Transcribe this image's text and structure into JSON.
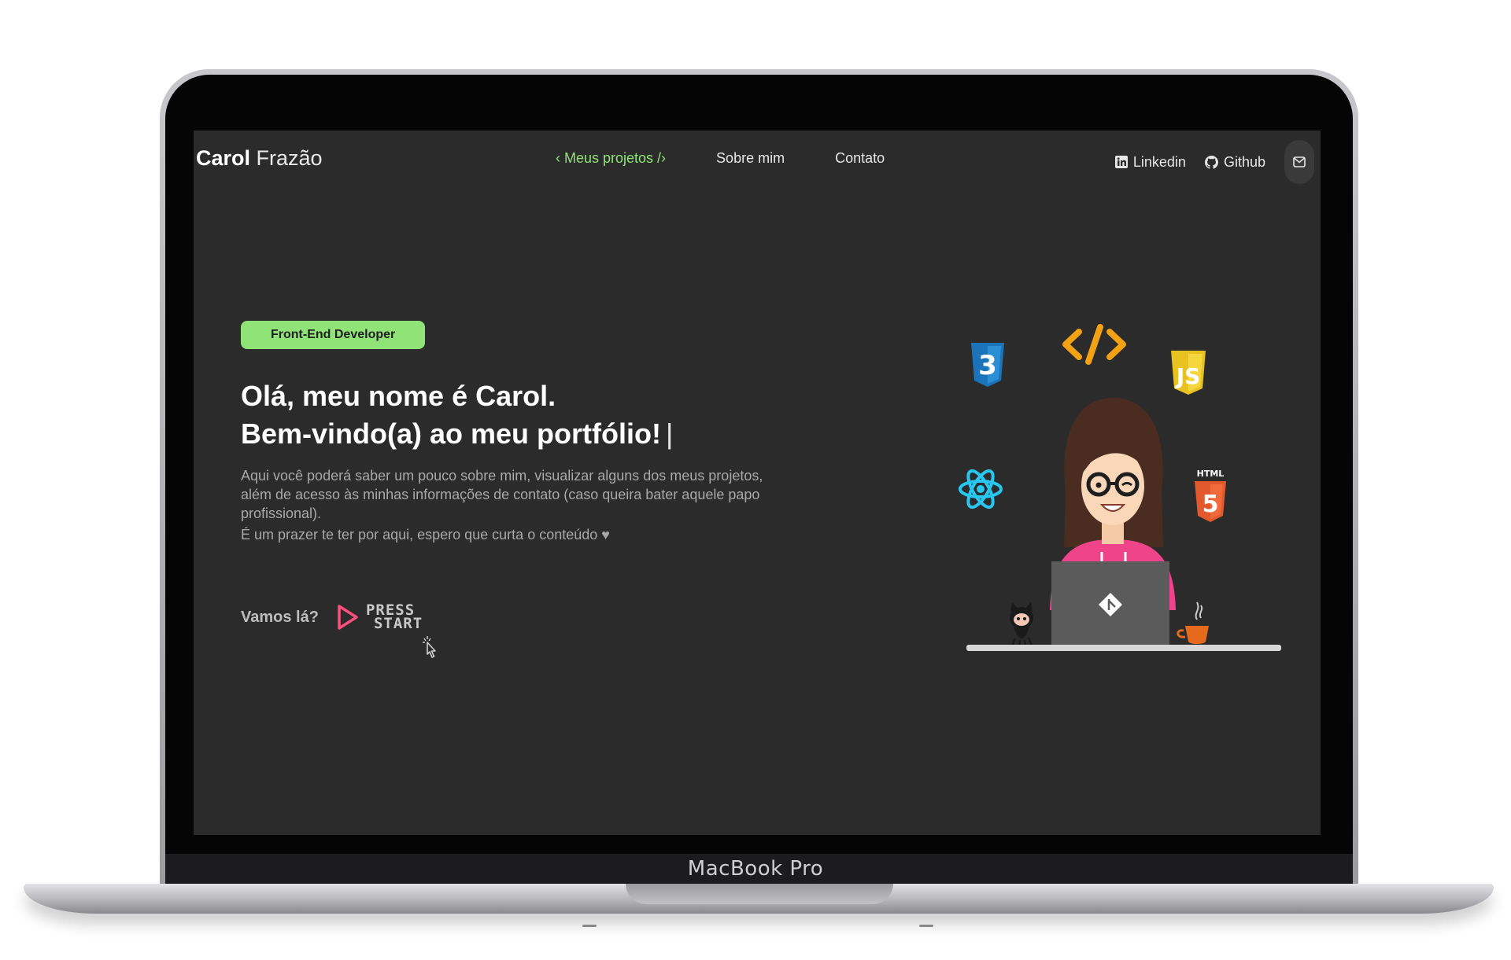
{
  "device": {
    "model_label": "MacBook Pro"
  },
  "nav": {
    "brand_first": "Carol",
    "brand_last": " Frazão",
    "links": [
      {
        "label": "‹ Meus projetos /›",
        "active": true
      },
      {
        "label": "Sobre mim",
        "active": false
      },
      {
        "label": "Contato",
        "active": false
      }
    ],
    "social": [
      {
        "label": "Linkedin",
        "icon": "linkedin-icon"
      },
      {
        "label": "Github",
        "icon": "github-icon"
      }
    ],
    "mail_icon": "mail-icon"
  },
  "hero": {
    "badge": "Front-End Developer",
    "title_line1": "Olá, meu nome é Carol.",
    "title_line2": "Bem-vindo(a) ao meu portfólio!",
    "caret": "|",
    "description_line1": "Aqui você poderá saber um pouco sobre mim, visualizar alguns dos meus projetos, além de acesso às minhas informações de contato (caso queira bater aquele papo profissional).",
    "description_line2": "É um prazer te ter por aqui, espero que curta o conteúdo ♥",
    "cta_label": "Vamos lá?",
    "press_line1": "PRESS",
    "press_line2": "START"
  },
  "illustration": {
    "code_symbol": "</>",
    "css_badge": "3",
    "js_badge": "JS",
    "html_label": "HTML",
    "html_badge": "5"
  },
  "colors": {
    "accent_green": "#8fe377",
    "screen_bg": "#2b2b2b",
    "hoodie_pink": "#f0448a",
    "play_pink": "#ff4f7b"
  }
}
